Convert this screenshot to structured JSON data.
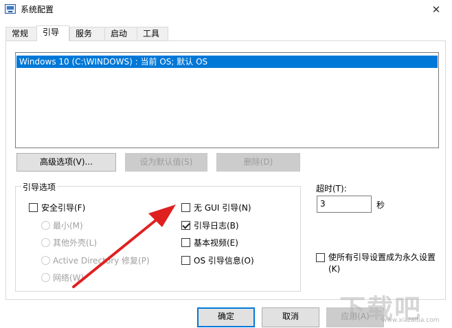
{
  "window": {
    "title": "系统配置",
    "close_glyph": "✕"
  },
  "tabs": [
    {
      "label": "常规",
      "active": false
    },
    {
      "label": "引导",
      "active": true
    },
    {
      "label": "服务",
      "active": false
    },
    {
      "label": "启动",
      "active": false
    },
    {
      "label": "工具",
      "active": false
    }
  ],
  "os_list": {
    "items": [
      "Windows 10 (C:\\WINDOWS) : 当前 OS; 默认 OS"
    ],
    "selected_index": 0
  },
  "buttons": {
    "advanced": "高级选项(V)...",
    "set_default": "设为默认值(S)",
    "delete": "删除(D)"
  },
  "boot_options": {
    "title": "引导选项",
    "safe_boot": {
      "label": "安全引导(F)",
      "checked": false
    },
    "radios": [
      "最小(M)",
      "其他外壳(L)",
      "Active Directory 修复(P)",
      "网络(W)"
    ],
    "no_gui": {
      "label": "无 GUI 引导(N)",
      "checked": false
    },
    "boot_log": {
      "label": "引导日志(B)",
      "checked": true
    },
    "base_video": {
      "label": "基本视频(E)",
      "checked": false
    },
    "os_info": {
      "label": "OS 引导信息(O)",
      "checked": false
    }
  },
  "timeout": {
    "label": "超时(T):",
    "value": "3",
    "unit": "秒"
  },
  "permanent": {
    "label_line1": "使所有引导设置成为永久设置",
    "label_line2": "(K)",
    "checked": false
  },
  "footer": {
    "ok": "确定",
    "cancel": "取消",
    "apply": "应用(A)"
  },
  "watermark": {
    "text": "下载吧",
    "url": "www.xiazaiba.com"
  },
  "colors": {
    "selection": "#0078d7",
    "arrow": "#e02020"
  },
  "icons": {
    "app": "msconfig-icon",
    "close": "close-icon",
    "annotation": "red-arrow-annotation"
  }
}
